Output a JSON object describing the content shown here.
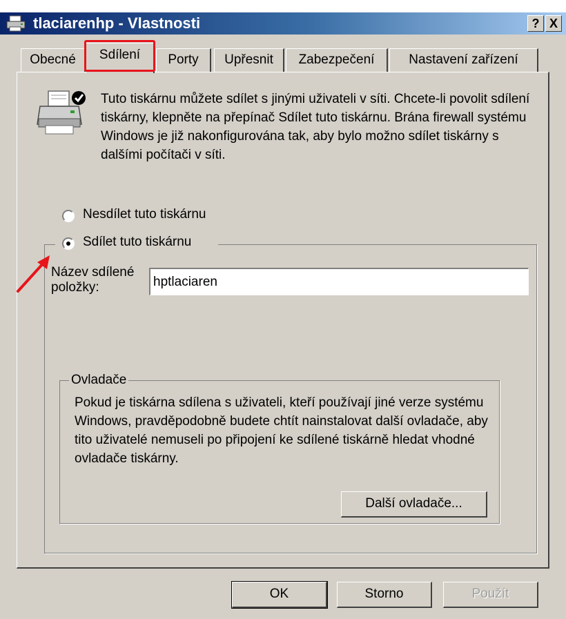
{
  "window": {
    "title": "tlaciarenhp - Vlastnosti",
    "help_label": "?",
    "close_label": "X"
  },
  "tabs": [
    {
      "label": "Obecné"
    },
    {
      "label": "Sdílení",
      "active": true
    },
    {
      "label": "Porty"
    },
    {
      "label": "Upřesnit"
    },
    {
      "label": "Zabezpečení"
    },
    {
      "label": "Nastavení zařízení"
    }
  ],
  "info": {
    "text": "Tuto tiskárnu můžete sdílet s jinými uživateli v síti. Chcete-li povolit sdílení tiskárny, klepněte na přepínač Sdílet tuto tiskárnu. Brána firewall systému Windows je již nakonfigurována tak, aby bylo možno sdílet tiskárny s dalšími počítači v síti."
  },
  "sharing": {
    "no_share_label": "Nesdílet tuto tiskárnu",
    "share_label": "Sdílet tuto tiskárnu",
    "selected": "share",
    "share_name_label": "Název sdílené položky:",
    "share_name_value": "hptlaciaren"
  },
  "drivers": {
    "legend": "Ovladače",
    "text": "Pokud je tiskárna sdílena s uživateli, kteří používají jiné verze systému Windows, pravděpodobně budete chtít nainstalovat další ovladače, aby tito uživatelé nemuseli po připojení ke sdílené tiskárně hledat vhodné ovladače tiskárny.",
    "button_label": "Další ovladače..."
  },
  "buttons": {
    "ok": "OK",
    "cancel": "Storno",
    "apply": "Použít"
  },
  "colors": {
    "highlight": "#e8141b",
    "title_bar": "#0a246a",
    "face": "#d4d0c8"
  }
}
